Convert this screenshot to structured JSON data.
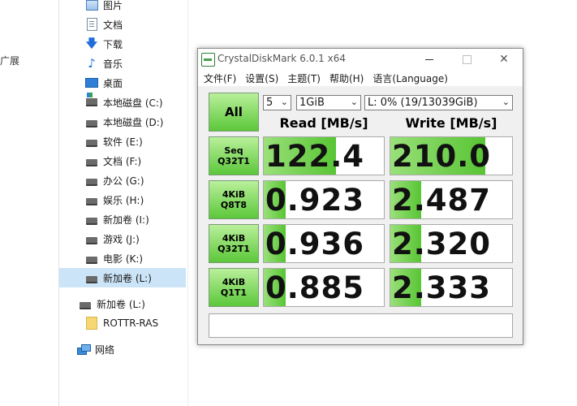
{
  "left_edge": {
    "fragment": "广展"
  },
  "nav": {
    "items": [
      {
        "label": "图片",
        "icon": "pictures-icon"
      },
      {
        "label": "文档",
        "icon": "documents-icon"
      },
      {
        "label": "下载",
        "icon": "download-icon"
      },
      {
        "label": "音乐",
        "icon": "music-icon"
      },
      {
        "label": "桌面",
        "icon": "desktop-icon"
      },
      {
        "label": "本地磁盘 (C:)",
        "icon": "system-drive-icon"
      },
      {
        "label": "本地磁盘 (D:)",
        "icon": "drive-icon"
      },
      {
        "label": "软件 (E:)",
        "icon": "drive-icon"
      },
      {
        "label": "文档 (F:)",
        "icon": "drive-icon"
      },
      {
        "label": "办公 (G:)",
        "icon": "drive-icon"
      },
      {
        "label": "娱乐 (H:)",
        "icon": "drive-icon"
      },
      {
        "label": "新加卷 (I:)",
        "icon": "drive-icon"
      },
      {
        "label": "游戏 (J:)",
        "icon": "drive-icon"
      },
      {
        "label": "电影 (K:)",
        "icon": "drive-icon"
      },
      {
        "label": "新加卷 (L:)",
        "icon": "drive-icon"
      },
      {
        "label": "新加卷 (L:)",
        "icon": "drive-icon"
      },
      {
        "label": "ROTTR-RAS",
        "icon": "folder-icon"
      },
      {
        "label": "网络",
        "icon": "network-icon"
      }
    ]
  },
  "cdm": {
    "title": "CrystalDiskMark 6.0.1 x64",
    "close_glyph": "✕",
    "menu": [
      "文件(F)",
      "设置(S)",
      "主题(T)",
      "帮助(H)",
      "语言(Language)"
    ],
    "all_label": "All",
    "count": "5",
    "size": "1GiB",
    "drive": "L: 0% (19/13039GiB)",
    "read_header": "Read [MB/s]",
    "write_header": "Write [MB/s]",
    "rows": [
      {
        "label_line1": "Seq",
        "label_line2": "Q32T1",
        "read": "122.4",
        "write": "210.0",
        "read_fill": 0.6,
        "write_fill": 0.78
      },
      {
        "label_line1": "4KiB",
        "label_line2": "Q8T8",
        "read": "0.923",
        "write": "2.487",
        "read_fill": 0.18,
        "write_fill": 0.25
      },
      {
        "label_line1": "4KiB",
        "label_line2": "Q32T1",
        "read": "0.936",
        "write": "2.320",
        "read_fill": 0.18,
        "write_fill": 0.25
      },
      {
        "label_line1": "4KiB",
        "label_line2": "Q1T1",
        "read": "0.885",
        "write": "2.333",
        "read_fill": 0.18,
        "write_fill": 0.25
      }
    ],
    "comment": ""
  }
}
